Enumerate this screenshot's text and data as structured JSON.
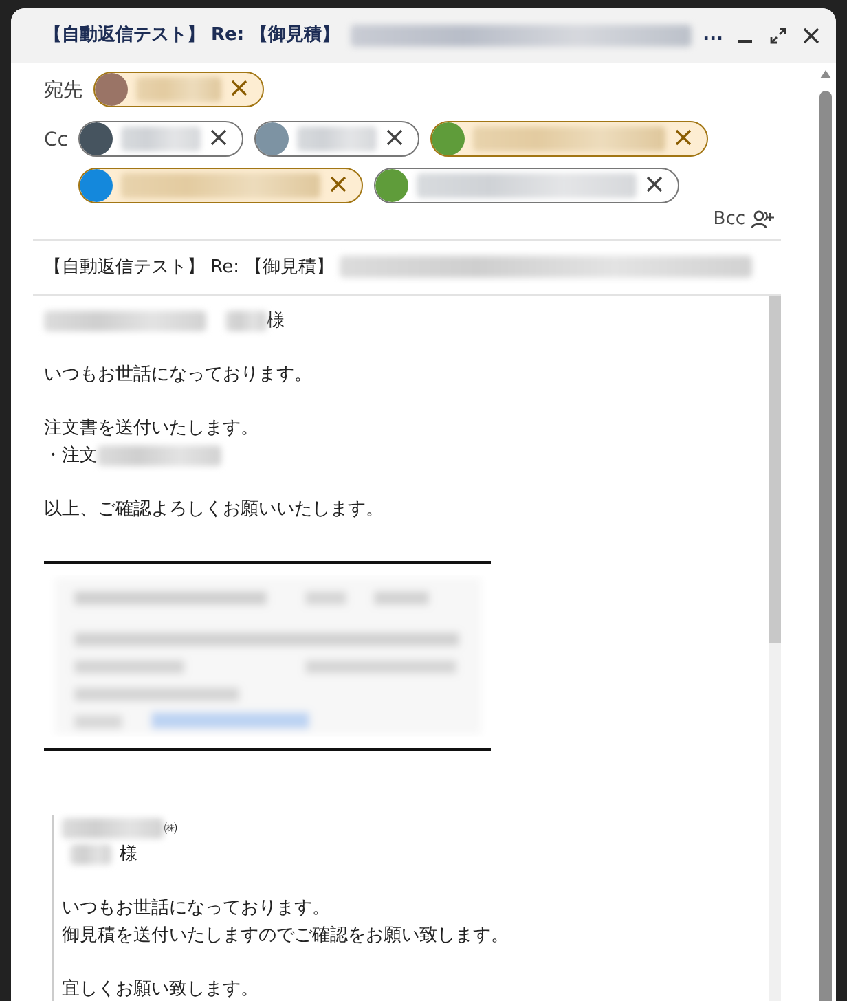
{
  "window": {
    "title": "【自動返信テスト】 Re: 【御見積】",
    "title_ellipsis": "..."
  },
  "recipients": {
    "to_label": "宛先",
    "to": [
      {
        "highlighted": true,
        "color": "#9a7466"
      }
    ],
    "cc_label": "Cc",
    "cc": [
      {
        "highlighted": false,
        "color": "#46545f"
      },
      {
        "highlighted": false,
        "color": "#7d93a3"
      },
      {
        "highlighted": true,
        "color": "#5f9c3a"
      },
      {
        "highlighted": true,
        "color": "#1488dc"
      },
      {
        "highlighted": false,
        "color": "#5f9c3a"
      }
    ],
    "bcc_label": "Bcc"
  },
  "subject": "【自動返信テスト】 Re: 【御見積】",
  "body": [
    {
      "kind": "addressee",
      "text": "様"
    },
    {
      "kind": "blank"
    },
    {
      "kind": "text",
      "text": "いつもお世話になっております。"
    },
    {
      "kind": "blank"
    },
    {
      "kind": "text",
      "text": "注文書を送付いたします。"
    },
    {
      "kind": "order",
      "text": "・注文"
    },
    {
      "kind": "blank"
    },
    {
      "kind": "text",
      "text": "以上、ご確認よろしくお願いいたします。"
    },
    {
      "kind": "blank"
    },
    {
      "kind": "rule"
    },
    {
      "kind": "signature"
    },
    {
      "kind": "rule"
    },
    {
      "kind": "blank"
    },
    {
      "kind": "blank"
    }
  ],
  "quote": [
    {
      "kind": "company",
      "text": "㈱"
    },
    {
      "kind": "addressee",
      "text": "様"
    },
    {
      "kind": "blank"
    },
    {
      "kind": "text",
      "text": "いつもお世話になっております。"
    },
    {
      "kind": "text",
      "text": "御見積を送付いたしますのでご確認をお願い致します。"
    },
    {
      "kind": "blank"
    },
    {
      "kind": "text",
      "text": "宜しくお願い致します。"
    }
  ]
}
